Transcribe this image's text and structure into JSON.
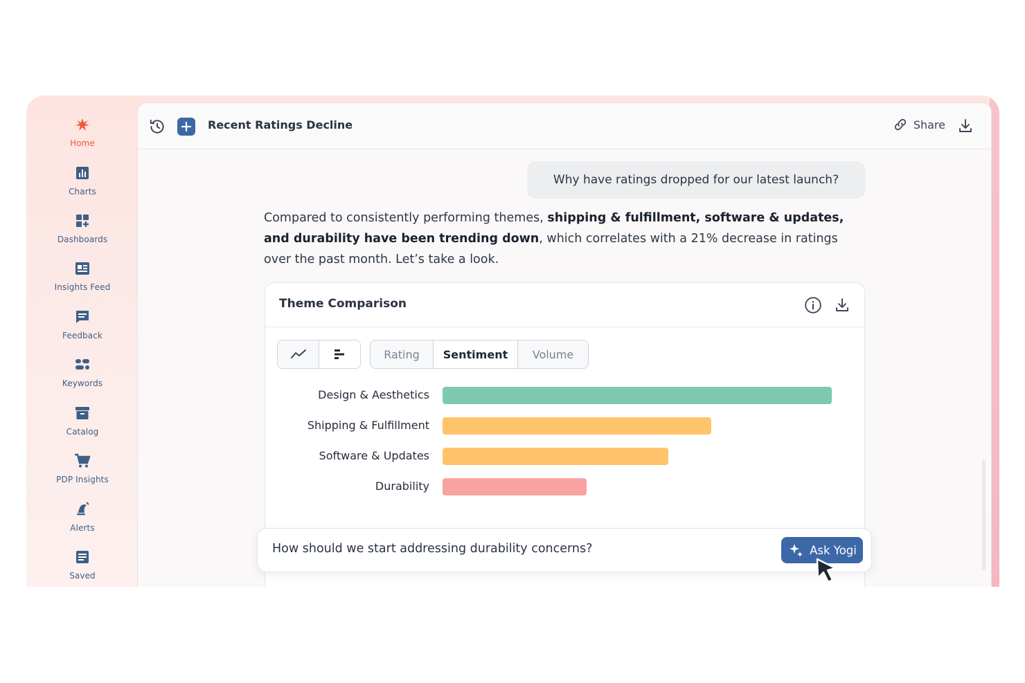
{
  "sidebar": {
    "items": [
      {
        "label": "Home",
        "icon": "logo-burst-icon",
        "active": true
      },
      {
        "label": "Charts",
        "icon": "bar-chart-icon"
      },
      {
        "label": "Dashboards",
        "icon": "dashboard-grid-icon"
      },
      {
        "label": "Insights Feed",
        "icon": "newspaper-icon"
      },
      {
        "label": "Feedback",
        "icon": "chat-bubble-icon"
      },
      {
        "label": "Keywords",
        "icon": "keywords-icon"
      },
      {
        "label": "Catalog",
        "icon": "archive-box-icon"
      },
      {
        "label": "PDP Insights",
        "icon": "shopping-cart-icon"
      },
      {
        "label": "Alerts",
        "icon": "alert-bell-icon"
      },
      {
        "label": "Saved",
        "icon": "saved-note-icon"
      }
    ],
    "accent": "#f05a3c",
    "icon_color": "#3e5f86"
  },
  "topbar": {
    "title": "Recent Ratings Decline",
    "share_label": "Share"
  },
  "conversation": {
    "question": "Why have ratings dropped for our latest launch?",
    "answer_intro": "Compared to consistently performing themes, ",
    "answer_bold": "shipping & fulfillment, software & updates, and durability have been trending down",
    "answer_rest": ", which correlates with a 21% decrease in ratings over the past month. Let’s take a look."
  },
  "card": {
    "title": "Theme Comparison",
    "metric_tabs": [
      {
        "label": "Rating"
      },
      {
        "label": "Sentiment",
        "active": true
      },
      {
        "label": "Volume"
      }
    ]
  },
  "chart_data": {
    "type": "bar",
    "orientation": "horizontal",
    "categories": [
      "Design & Aesthetics",
      "Shipping & Fulfillment",
      "Software & Updates",
      "Durability"
    ],
    "values": [
      100,
      69,
      58,
      37
    ],
    "xlim": [
      0,
      100
    ],
    "colors": [
      "#7fc8b1",
      "#ffc46b",
      "#ffc46b",
      "#f8a3a1"
    ],
    "grid": false
  },
  "ask": {
    "placeholder_text": "How should we start addressing durability concerns?",
    "button_label": "Ask Yogi",
    "button_color": "#3d68a8"
  }
}
